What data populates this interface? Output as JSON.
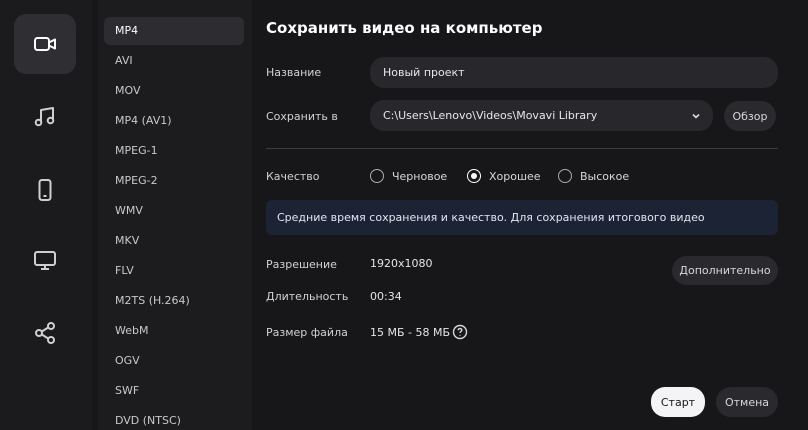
{
  "rail": {
    "icons": [
      "video-icon",
      "music-icon",
      "phone-icon",
      "tv-icon",
      "share-icon"
    ],
    "active": "video-icon"
  },
  "formats": {
    "items": [
      "MP4",
      "AVI",
      "MOV",
      "MP4 (AV1)",
      "MPEG-1",
      "MPEG-2",
      "WMV",
      "MKV",
      "FLV",
      "M2TS (H.264)",
      "WebM",
      "OGV",
      "SWF",
      "DVD (NTSC)"
    ],
    "selected": "MP4"
  },
  "main": {
    "title": "Сохранить видео на компьютер",
    "name_label": "Название",
    "name_value": "Новый проект",
    "save_to_label": "Сохранить в",
    "save_to_value": "C:\\Users\\Lenovo\\Videos\\Movavi Library",
    "browse_label": "Обзор",
    "quality_label": "Качество",
    "quality_options": [
      "Черновое",
      "Хорошее",
      "Высокое"
    ],
    "quality_selected": "Хорошее",
    "info_text": "Средние время сохранения и качество. Для сохранения итогового видео",
    "resolution_label": "Разрешение",
    "resolution_value": "1920x1080",
    "duration_label": "Длительность",
    "duration_value": "00:34",
    "filesize_label": "Размер файла",
    "filesize_value": "15 МБ - 58 МБ",
    "more_label": "Дополнительно",
    "start_label": "Старт",
    "cancel_label": "Отмена"
  },
  "colors": {
    "background": "#171719",
    "rail_active": "#2e2e33",
    "info_box": "#1c2334",
    "start_button": "#f4f4f6"
  }
}
